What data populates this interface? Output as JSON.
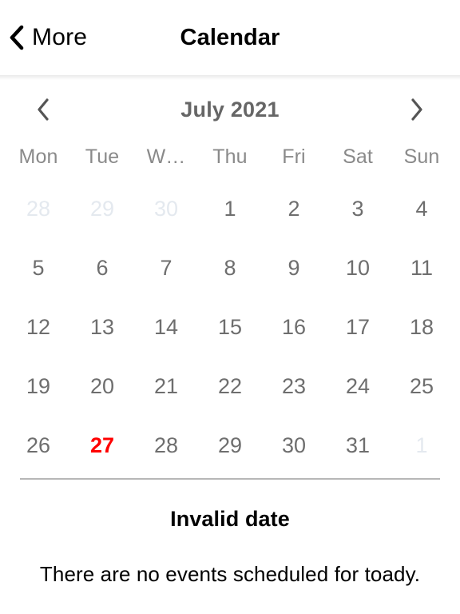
{
  "navbar": {
    "back_label": "More",
    "back_icon": "chevron-left-icon",
    "title": "Calendar"
  },
  "calendar": {
    "month_label": "July 2021",
    "prev_icon": "chevron-left-icon",
    "next_icon": "chevron-right-icon",
    "weekdays": [
      "Mon",
      "Tue",
      "W…",
      "Thu",
      "Fri",
      "Sat",
      "Sun"
    ],
    "weeks": [
      [
        {
          "day": "28",
          "state": "muted"
        },
        {
          "day": "29",
          "state": "muted"
        },
        {
          "day": "30",
          "state": "muted"
        },
        {
          "day": "1",
          "state": "normal"
        },
        {
          "day": "2",
          "state": "normal"
        },
        {
          "day": "3",
          "state": "normal"
        },
        {
          "day": "4",
          "state": "normal"
        }
      ],
      [
        {
          "day": "5",
          "state": "normal"
        },
        {
          "day": "6",
          "state": "normal"
        },
        {
          "day": "7",
          "state": "normal"
        },
        {
          "day": "8",
          "state": "normal"
        },
        {
          "day": "9",
          "state": "normal"
        },
        {
          "day": "10",
          "state": "normal"
        },
        {
          "day": "11",
          "state": "normal"
        }
      ],
      [
        {
          "day": "12",
          "state": "normal"
        },
        {
          "day": "13",
          "state": "normal"
        },
        {
          "day": "14",
          "state": "normal"
        },
        {
          "day": "15",
          "state": "normal"
        },
        {
          "day": "16",
          "state": "normal"
        },
        {
          "day": "17",
          "state": "normal"
        },
        {
          "day": "18",
          "state": "normal"
        }
      ],
      [
        {
          "day": "19",
          "state": "normal"
        },
        {
          "day": "20",
          "state": "normal"
        },
        {
          "day": "21",
          "state": "normal"
        },
        {
          "day": "22",
          "state": "normal"
        },
        {
          "day": "23",
          "state": "normal"
        },
        {
          "day": "24",
          "state": "normal"
        },
        {
          "day": "25",
          "state": "normal"
        }
      ],
      [
        {
          "day": "26",
          "state": "normal"
        },
        {
          "day": "27",
          "state": "today"
        },
        {
          "day": "28",
          "state": "normal"
        },
        {
          "day": "29",
          "state": "normal"
        },
        {
          "day": "30",
          "state": "normal"
        },
        {
          "day": "31",
          "state": "normal"
        },
        {
          "day": "1",
          "state": "muted"
        }
      ]
    ]
  },
  "detail": {
    "title": "Invalid date",
    "message": "There are no events scheduled for toady."
  },
  "colors": {
    "today": "#ff0000",
    "date_text": "#6e6e6e",
    "muted_date_text": "#e4e9ef",
    "weekday_text": "#8a8a8a",
    "month_label_text": "#666666",
    "divider": "#b7b7b7",
    "background": "#ffffff"
  }
}
